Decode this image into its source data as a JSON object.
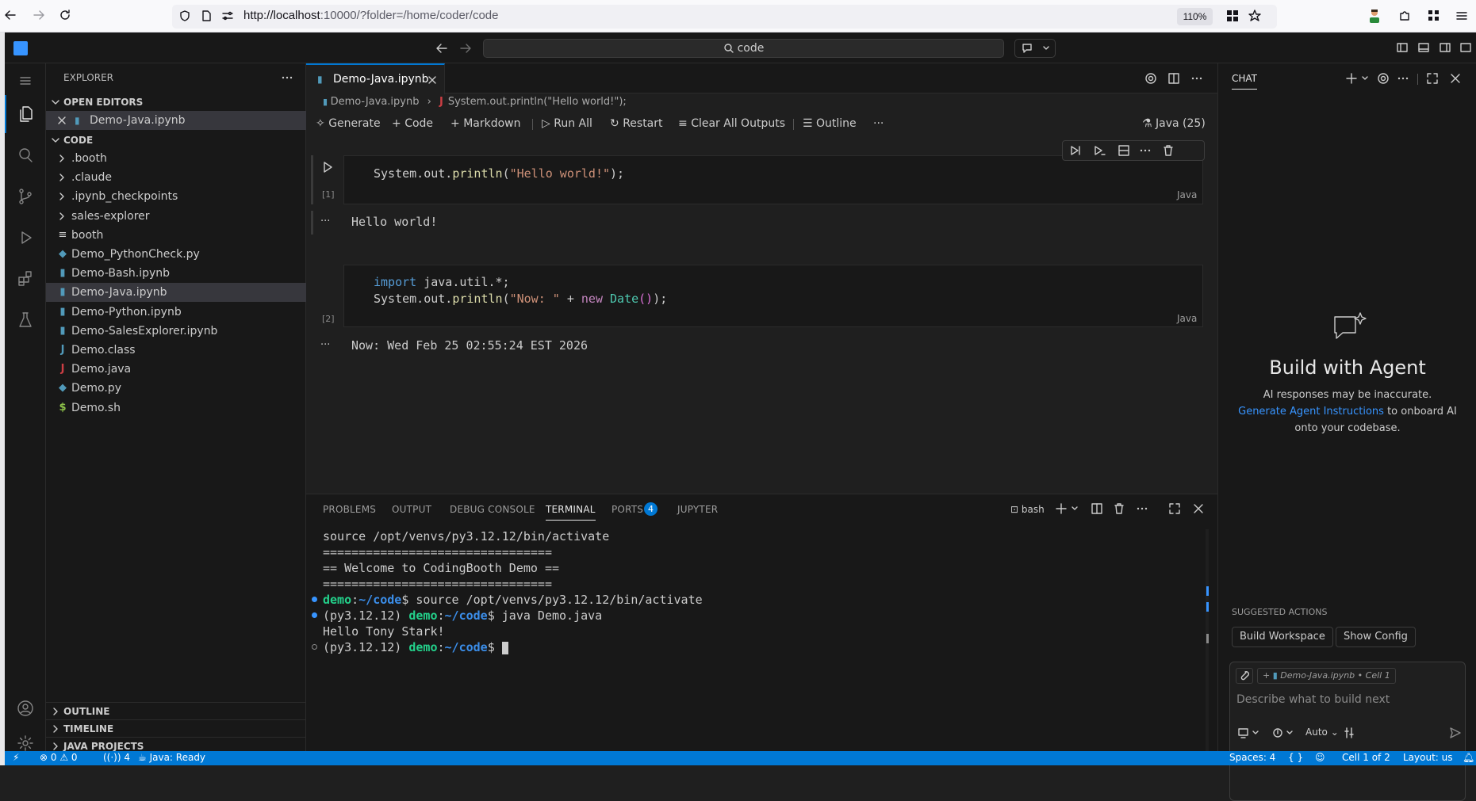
{
  "browser": {
    "url_host": "http://localhost",
    "url_rest": ":10000/?folder=/home/coder/code",
    "zoom": "110%"
  },
  "titlebar": {
    "search": "code"
  },
  "sidebar": {
    "title": "EXPLORER",
    "open_editors": {
      "header": "OPEN EDITORS",
      "items": [
        "Demo-Java.ipynb"
      ]
    },
    "folder": {
      "header": "CODE",
      "items": [
        {
          "label": ".booth",
          "icon": "chevron-right",
          "color": "#cccccc"
        },
        {
          "label": ".claude",
          "icon": "chevron-right",
          "color": "#cccccc"
        },
        {
          "label": ".ipynb_checkpoints",
          "icon": "chevron-right",
          "color": "#cccccc"
        },
        {
          "label": "sales-explorer",
          "icon": "chevron-right",
          "color": "#cccccc"
        },
        {
          "label": "booth",
          "icon": "lines",
          "color": "#cccccc"
        },
        {
          "label": "Demo_PythonCheck.py",
          "icon": "python",
          "color": "#519aba"
        },
        {
          "label": "Demo-Bash.ipynb",
          "icon": "notebook",
          "color": "#519aba"
        },
        {
          "label": "Demo-Java.ipynb",
          "icon": "notebook",
          "color": "#519aba"
        },
        {
          "label": "Demo-Python.ipynb",
          "icon": "notebook",
          "color": "#519aba"
        },
        {
          "label": "Demo-SalesExplorer.ipynb",
          "icon": "notebook",
          "color": "#519aba"
        },
        {
          "label": "Demo.class",
          "icon": "J",
          "color": "#519aba"
        },
        {
          "label": "Demo.java",
          "icon": "J",
          "color": "#cc3e44"
        },
        {
          "label": "Demo.py",
          "icon": "python",
          "color": "#519aba"
        },
        {
          "label": "Demo.sh",
          "icon": "$",
          "color": "#8dc149"
        }
      ]
    },
    "bottom_sections": [
      "OUTLINE",
      "TIMELINE",
      "JAVA PROJECTS"
    ]
  },
  "editor": {
    "tab": "Demo-Java.ipynb",
    "breadcrumb": {
      "file": "Demo-Java.ipynb",
      "symbol": "System.out.println(\"Hello world!\");"
    },
    "toolbar": {
      "generate": "Generate",
      "code": "Code",
      "markdown": "Markdown",
      "run_all": "Run All",
      "restart": "Restart",
      "clear": "Clear All Outputs",
      "outline": "Outline",
      "kernel": "Java (25)"
    },
    "cells": [
      {
        "exec": "[1]",
        "lang": "Java",
        "output": "Hello world!"
      },
      {
        "exec": "[2]",
        "lang": "Java",
        "output": "Now: Wed Feb 25 02:55:24 EST 2026"
      }
    ]
  },
  "panel": {
    "tabs": [
      "PROBLEMS",
      "OUTPUT",
      "DEBUG CONSOLE",
      "TERMINAL",
      "PORTS",
      "JUPYTER"
    ],
    "ports_badge": "4",
    "shell": "bash",
    "terminal": {
      "l1": "source /opt/venvs/py3.12.12/bin/activate",
      "sep": "================================",
      "welcome": "== Welcome to CodingBooth Demo ==",
      "user": "demo",
      "path": "~/code",
      "cmd1": "$ source /opt/venvs/py3.12.12/bin/activate",
      "venv": "(py3.12.12) ",
      "cmd2": "$ java Demo.java",
      "out": "Hello Tony Stark!",
      "prompt": "$ "
    }
  },
  "chat": {
    "title": "CHAT",
    "heading": "Build with Agent",
    "sub": "AI responses may be inaccurate.",
    "link": "Generate Agent Instructions",
    "link_rest1": " to onboard AI",
    "link_rest2": "onto your codebase.",
    "suggested": "SUGGESTED ACTIONS",
    "actions": [
      "Build Workspace",
      "Show Config"
    ],
    "context": "Demo-Java.ipynb • Cell 1",
    "placeholder": "Describe what to build next",
    "mode": "Auto"
  },
  "status": {
    "errors": "0",
    "warnings": "0",
    "ports": "4",
    "java": "Java: Ready",
    "spaces": "Spaces: 4",
    "cell": "Cell 1 of 2",
    "layout": "Layout: us"
  }
}
